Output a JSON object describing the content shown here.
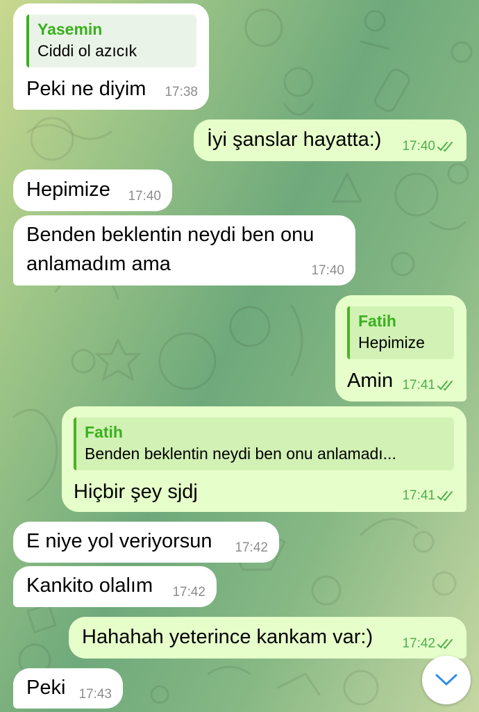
{
  "chat": {
    "messages": [
      {
        "direction": "in",
        "reply": {
          "name": "Yasemin",
          "text": "Ciddi ol azıcık"
        },
        "text": "Peki ne diyim",
        "time": "17:38"
      },
      {
        "direction": "out",
        "text": "İyi şanslar hayatta:)",
        "time": "17:40",
        "status": "read"
      },
      {
        "direction": "in",
        "text": "Hepimize",
        "time": "17:40"
      },
      {
        "direction": "in",
        "text": "Benden beklentin neydi ben onu anlamadım ama",
        "time": "17:40"
      },
      {
        "direction": "out",
        "reply": {
          "name": "Fatih",
          "text": "Hepimize"
        },
        "text": "Amin",
        "time": "17:41",
        "status": "read"
      },
      {
        "direction": "out",
        "reply": {
          "name": "Fatih",
          "text": "Benden beklentin neydi ben onu anlamadı..."
        },
        "text": "Hiçbir şey sjdj",
        "time": "17:41",
        "status": "read"
      },
      {
        "direction": "in",
        "text": "E niye yol veriyorsun",
        "time": "17:42"
      },
      {
        "direction": "in",
        "text": "Kankito olalım",
        "time": "17:42"
      },
      {
        "direction": "out",
        "text": "Hahahah yeterince kankam var:)",
        "time": "17:42",
        "status": "read"
      },
      {
        "direction": "in",
        "text": "Peki",
        "time": "17:43"
      }
    ]
  },
  "colors": {
    "incoming_bubble": "#ffffff",
    "outgoing_bubble": "#e6ffca",
    "reply_accent": "#3ab01e",
    "outgoing_time": "#4fae4e",
    "incoming_time": "#8c8c8c"
  },
  "scroll_button": {
    "icon": "chevron-down-icon"
  }
}
